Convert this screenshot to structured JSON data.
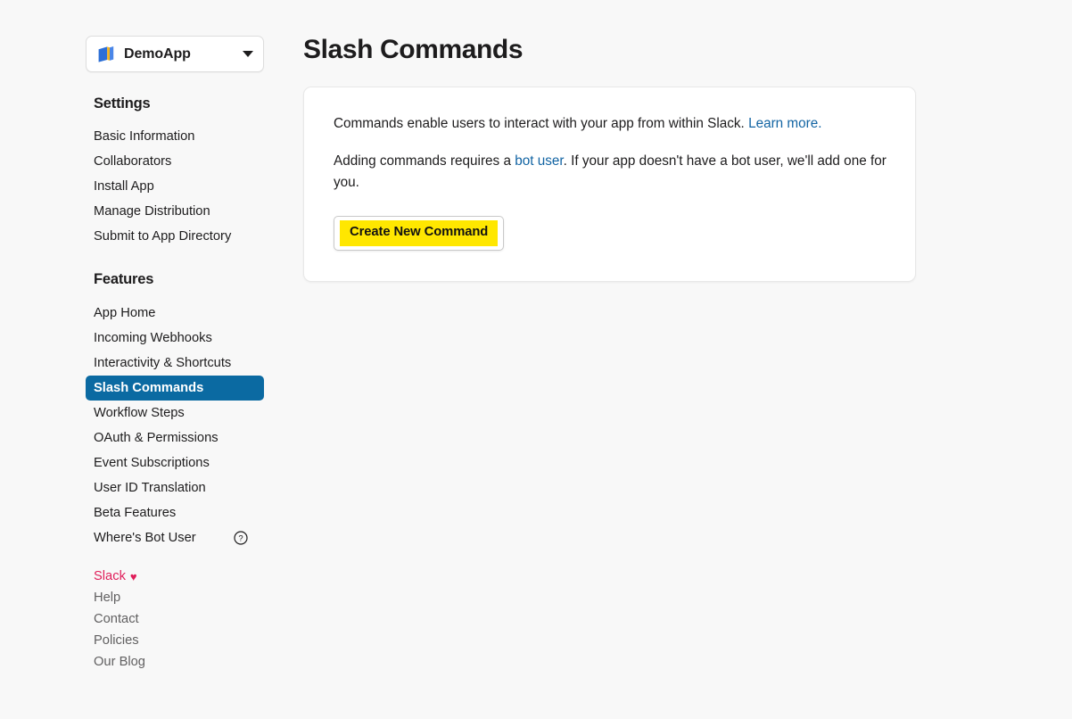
{
  "app_selector": {
    "name": "DemoApp",
    "icon": "app-book-icon",
    "chevron": "chevron-down-icon"
  },
  "sidebar": {
    "sections": [
      {
        "heading": "Settings",
        "items": [
          {
            "label": "Basic Information",
            "active": false
          },
          {
            "label": "Collaborators",
            "active": false
          },
          {
            "label": "Install App",
            "active": false
          },
          {
            "label": "Manage Distribution",
            "active": false
          },
          {
            "label": "Submit to App Directory",
            "active": false
          }
        ]
      },
      {
        "heading": "Features",
        "items": [
          {
            "label": "App Home",
            "active": false
          },
          {
            "label": "Incoming Webhooks",
            "active": false
          },
          {
            "label": "Interactivity & Shortcuts",
            "active": false
          },
          {
            "label": "Slash Commands",
            "active": true
          },
          {
            "label": "Workflow Steps",
            "active": false
          },
          {
            "label": "OAuth & Permissions",
            "active": false
          },
          {
            "label": "Event Subscriptions",
            "active": false
          },
          {
            "label": "User ID Translation",
            "active": false
          },
          {
            "label": "Beta Features",
            "active": false
          },
          {
            "label": "Where's Bot User",
            "active": false,
            "icon": "help-circle-icon"
          }
        ]
      }
    ]
  },
  "footer": {
    "links": [
      {
        "label": "Slack",
        "brand": true,
        "heart": "♥"
      },
      {
        "label": "Help",
        "brand": false
      },
      {
        "label": "Contact",
        "brand": false
      },
      {
        "label": "Policies",
        "brand": false
      },
      {
        "label": "Our Blog",
        "brand": false
      }
    ]
  },
  "main": {
    "title": "Slash Commands",
    "card": {
      "para1": {
        "text_before": "Commands enable users to interact with your app from within Slack. ",
        "link": "Learn more.",
        "text_after": ""
      },
      "para2": {
        "text_before": "Adding commands requires a ",
        "link": "bot user",
        "text_after": ". If your app doesn't have a bot user, we'll add one for you."
      },
      "create_button": "Create New Command"
    }
  },
  "colors": {
    "page_background": "#f8f8f8",
    "card_background": "#ffffff",
    "active_nav": "#0b6aa2",
    "link": "#1264a3",
    "brand_pink": "#e01e5a",
    "highlight_yellow": "#ffe700",
    "text": "#1d1c1d",
    "muted_text": "#616061"
  }
}
